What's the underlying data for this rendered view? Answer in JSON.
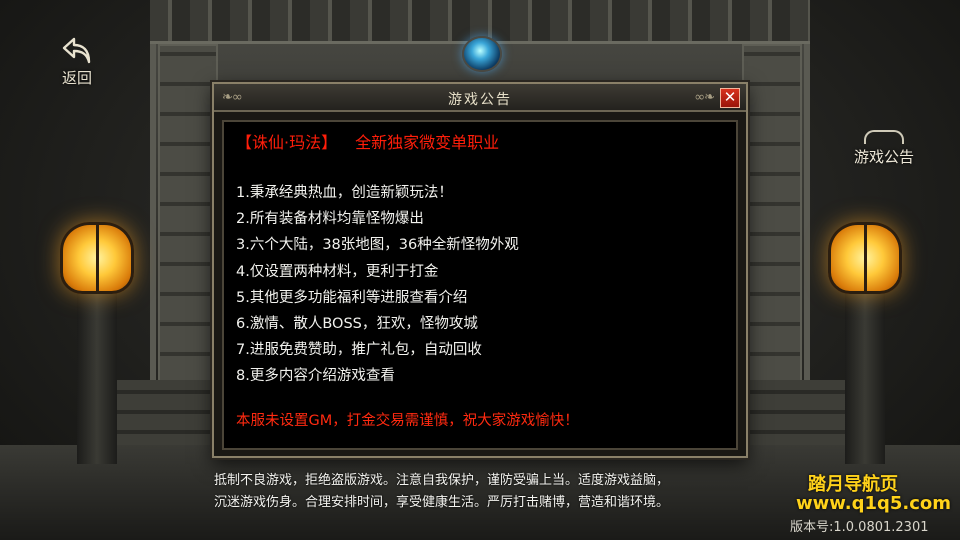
{
  "nav": {
    "back_label": "返回",
    "notice_label": "游戏公告"
  },
  "dialog": {
    "title": "游戏公告",
    "close_glyph": "✕",
    "headline_tag": "【诛仙·玛法】",
    "headline_text": "全新独家微变单职业",
    "items": [
      "1.秉承经典热血，创造新颖玩法！",
      "2.所有装备材料均靠怪物爆出",
      "3.六个大陆，38张地图，36种全新怪物外观",
      "4.仅设置两种材料，更利于打金",
      "5.其他更多功能福利等进服查看介绍",
      "6.激情、散人BOSS，狂欢，怪物攻城",
      "7.进服免费赞助，推广礼包，自动回收",
      "8.更多内容介绍游戏查看"
    ],
    "warning": "本服未设置GM，打金交易需谨慎，祝大家游戏愉快！"
  },
  "footer": {
    "disclaimer_line1": "抵制不良游戏，拒绝盗版游戏。注意自我保护，谨防受骗上当。适度游戏益脑，",
    "disclaimer_line2": "沉迷游戏伤身。合理安排时间，享受健康生活。严厉打击赌博，营造和谐环境。",
    "brand_name": "踏月导航页",
    "brand_url": "www.q1q5.com",
    "version": "版本号:1.0.0801.2301"
  },
  "colors": {
    "headline_red": "#ff1e0a",
    "brand_yellow": "#ffd21a",
    "close_red": "#c8240f"
  }
}
